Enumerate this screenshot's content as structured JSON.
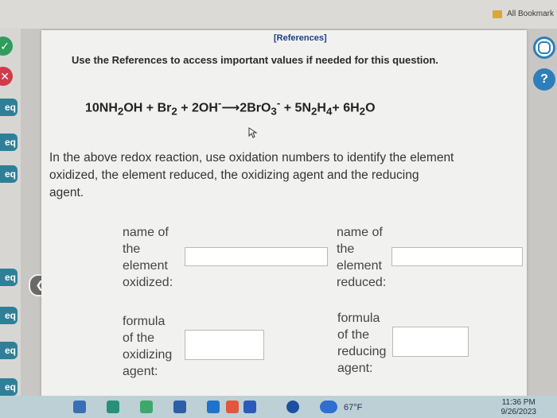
{
  "browser": {
    "bookmarks_label": "All Bookmark"
  },
  "page": {
    "references_link": "[References]",
    "instruction": "Use the References to access important values if needed for this question.",
    "equation": {
      "lhs1": "10NH",
      "lhs1_sub": "2",
      "lhs1_tail": "OH + Br",
      "br_sub": "2",
      "lhs2": "+ 2OH",
      "lhs2_sup": "-",
      "arrow": "⟶",
      "rhs1": "2BrO",
      "rhs1_sub": "3",
      "rhs1_sup": "-",
      "rhs2": " + 5N",
      "rhs2_sub1": "2",
      "rhs2_mid": "H",
      "rhs2_sub2": "4",
      "rhs3": "+ 6H",
      "rhs3_sub": "2",
      "rhs3_tail": "O"
    },
    "question": "In the above redox reaction, use oxidation numbers to identify the element oxidized, the element reduced, the oxidizing agent and the reducing agent.",
    "fields": {
      "element_oxidized": "name of\nthe\nelement\noxidized:",
      "element_reduced": "name of\nthe\nelement\nreduced:",
      "oxidizing_agent": "formula\nof the\noxidizing\nagent:",
      "reducing_agent": "formula\nof the\nreducing\nagent:"
    }
  },
  "left_rail": [
    "eq",
    "eq",
    "eq",
    "eq",
    "eq",
    "eq",
    "eq"
  ],
  "taskbar": {
    "weather": "67°F",
    "time": "11:36 PM",
    "date": "9/26/2023"
  },
  "colors": {
    "teal": "#2f7f98",
    "link": "#1b3e87",
    "help_button": "#2c7fbb"
  }
}
